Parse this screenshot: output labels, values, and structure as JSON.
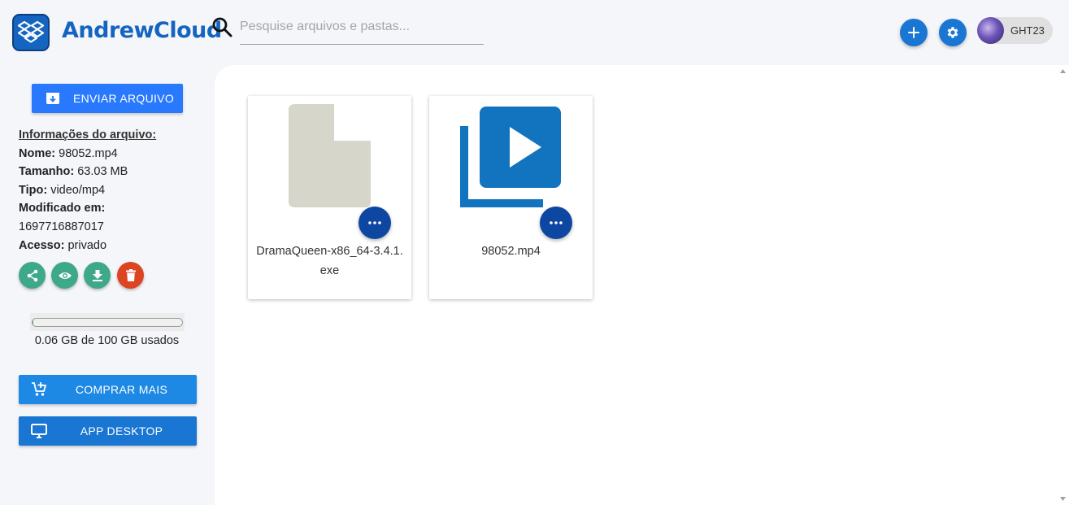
{
  "app": {
    "title": "AndrewCloud"
  },
  "search": {
    "placeholder": "Pesquise arquivos e pastas..."
  },
  "header": {
    "user": {
      "name": "GHT23"
    }
  },
  "sidebar": {
    "upload_label": "ENVIAR ARQUIVO",
    "info": {
      "title": "Informações do arquivo:",
      "name_label": "Nome:",
      "name_value": "98052.mp4",
      "size_label": "Tamanho:",
      "size_value": "63.03 MB",
      "type_label": "Tipo:",
      "type_value": "video/mp4",
      "modified_label": "Modificado em:",
      "modified_value": "1697716887017",
      "access_label": "Acesso:",
      "access_value": "privado"
    },
    "storage": {
      "text": "0.06 GB de 100 GB usados",
      "used_fraction": 0.0006
    },
    "buy_label": "COMPRAR MAIS",
    "desktop_label": "APP DESKTOP"
  },
  "files": [
    {
      "name": "DramaQueen-x86_64-3.4.1.exe",
      "icon": "generic-file-icon"
    },
    {
      "name": "98052.mp4",
      "icon": "video-library-icon"
    }
  ],
  "colors": {
    "brand": "#1565c0",
    "upload": "#2979ff",
    "teal_action": "#3ea88a",
    "delete_action": "#dd4422",
    "buy": "#1e88e5",
    "desktop": "#1976d2",
    "more_button": "#0d47a1",
    "video_icon": "#1274bf",
    "file_icon": "#d6d6cb"
  }
}
